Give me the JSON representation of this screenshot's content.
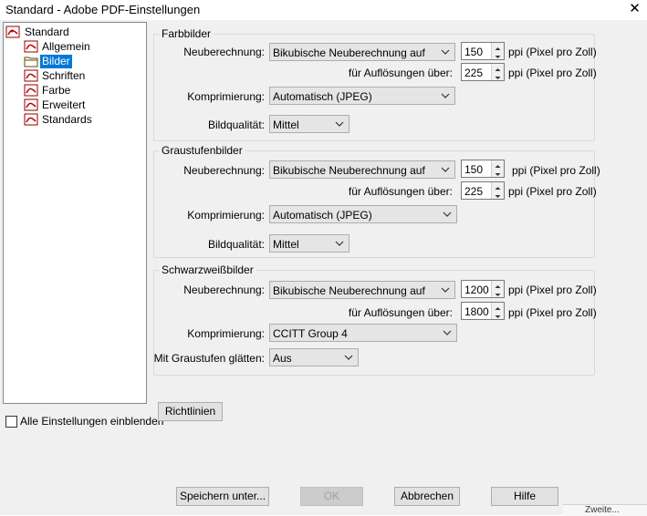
{
  "window": {
    "title": "Standard - Adobe PDF-Einstellungen"
  },
  "tree": {
    "root": "Standard",
    "items": [
      {
        "label": "Allgemein"
      },
      {
        "label": "Bilder"
      },
      {
        "label": "Schriften"
      },
      {
        "label": "Farbe"
      },
      {
        "label": "Erweitert"
      },
      {
        "label": "Standards"
      }
    ],
    "selected": "Bilder"
  },
  "show_all": {
    "label": "Alle Einstellungen einblenden"
  },
  "labels": {
    "resample": "Neuberechnung:",
    "for_res": "für Auflösungen über:",
    "compression": "Komprimierung:",
    "quality": "Bildqualität:",
    "smooth": "Mit Graustufen glätten:",
    "unit": "ppi (Pixel pro Zoll)"
  },
  "color": {
    "title": "Farbbilder",
    "resample": "Bikubische Neuberechnung auf",
    "ppi": "150",
    "above": "225",
    "compression": "Automatisch (JPEG)",
    "quality": "Mittel"
  },
  "gray": {
    "title": "Graustufenbilder",
    "resample": "Bikubische Neuberechnung auf",
    "ppi": "150",
    "above": "225",
    "compression": "Automatisch (JPEG)",
    "quality": "Mittel"
  },
  "mono": {
    "title": "Schwarzweißbilder",
    "resample": "Bikubische Neuberechnung auf",
    "ppi": "1200",
    "above": "1800",
    "compression": "CCITT Group 4",
    "smoothing": "Aus"
  },
  "buttons": {
    "guidelines": "Richtlinien",
    "save_as": "Speichern unter...",
    "ok": "OK",
    "cancel": "Abbrechen",
    "help": "Hilfe"
  },
  "background_fragment": "Zweite..."
}
